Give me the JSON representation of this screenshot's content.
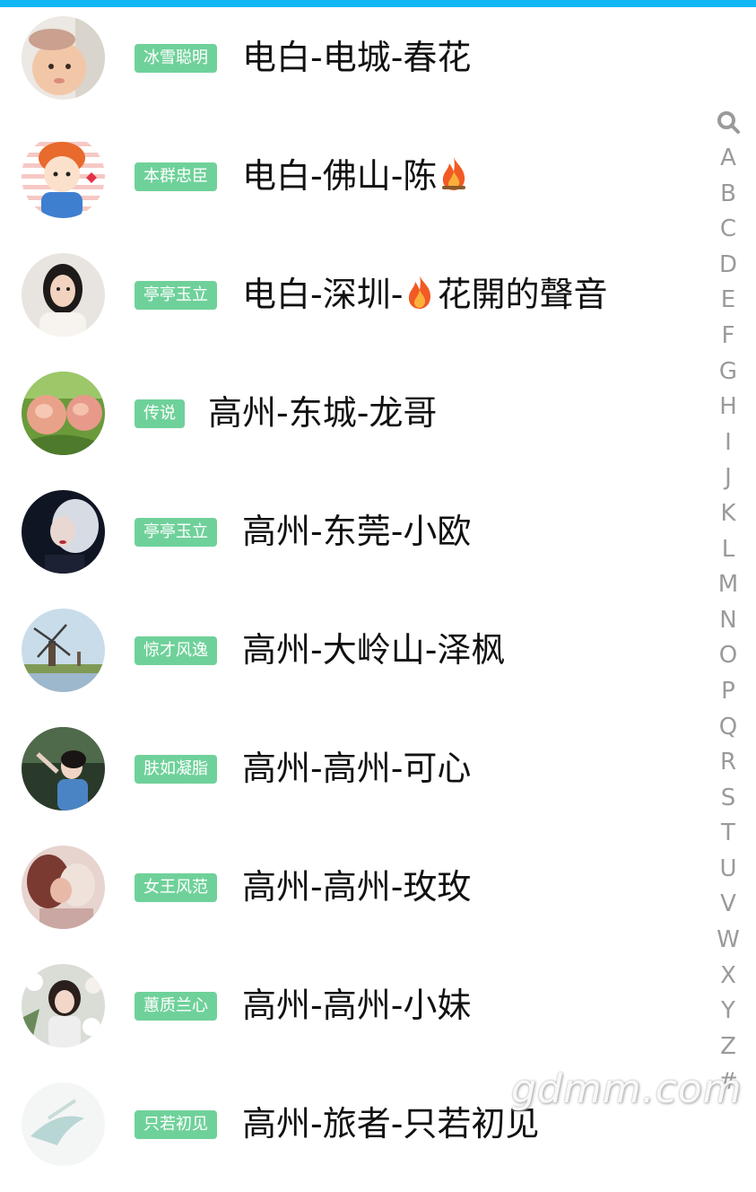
{
  "colors": {
    "accent_bar": "#12b7f5",
    "badge_bg": "#6fd19a",
    "badge_text": "#ffffff",
    "name_text": "#111111",
    "index_text": "#9a9a9a"
  },
  "members": [
    {
      "badge": "冰雪聪明",
      "name": "电白-电城-春花",
      "emoji": null,
      "avatar": "baby-photo"
    },
    {
      "badge": "本群忠臣",
      "name": "电白-佛山-陈",
      "emoji": "fire-icon",
      "avatar": "cartoon-boy"
    },
    {
      "badge": "亭亭玉立",
      "name_prefix": "电白-深圳-",
      "name": "花開的聲音",
      "emoji": "fire-icon",
      "avatar": "woman-photo"
    },
    {
      "badge": "传说",
      "name": "高州-东城-龙哥",
      "emoji": null,
      "avatar": "peaches-photo"
    },
    {
      "badge": "亭亭玉立",
      "name": "高州-东莞-小欧",
      "emoji": null,
      "avatar": "dark-portrait"
    },
    {
      "badge": "惊才风逸",
      "name": "高州-大岭山-泽枫",
      "emoji": null,
      "avatar": "windmill-photo"
    },
    {
      "badge": "肤如凝脂",
      "name": "高州-高州-可心",
      "emoji": null,
      "avatar": "woman-outdoor"
    },
    {
      "badge": "女王风范",
      "name": "高州-高州-玫玫",
      "emoji": null,
      "avatar": "couple-photo"
    },
    {
      "badge": "蕙质兰心",
      "name": "高州-高州-小妹",
      "emoji": null,
      "avatar": "woman-flowers"
    },
    {
      "badge": "只若初见",
      "name": "高州-旅者-只若初见",
      "emoji": null,
      "avatar": "sketch-avatar"
    }
  ],
  "index_bar": {
    "search_icon": "search-icon",
    "letters": [
      "A",
      "B",
      "C",
      "D",
      "E",
      "F",
      "G",
      "H",
      "I",
      "J",
      "K",
      "L",
      "M",
      "N",
      "O",
      "P",
      "Q",
      "R",
      "S",
      "T",
      "U",
      "V",
      "W",
      "X",
      "Y",
      "Z",
      "#"
    ]
  },
  "watermark": "gdmm.com"
}
